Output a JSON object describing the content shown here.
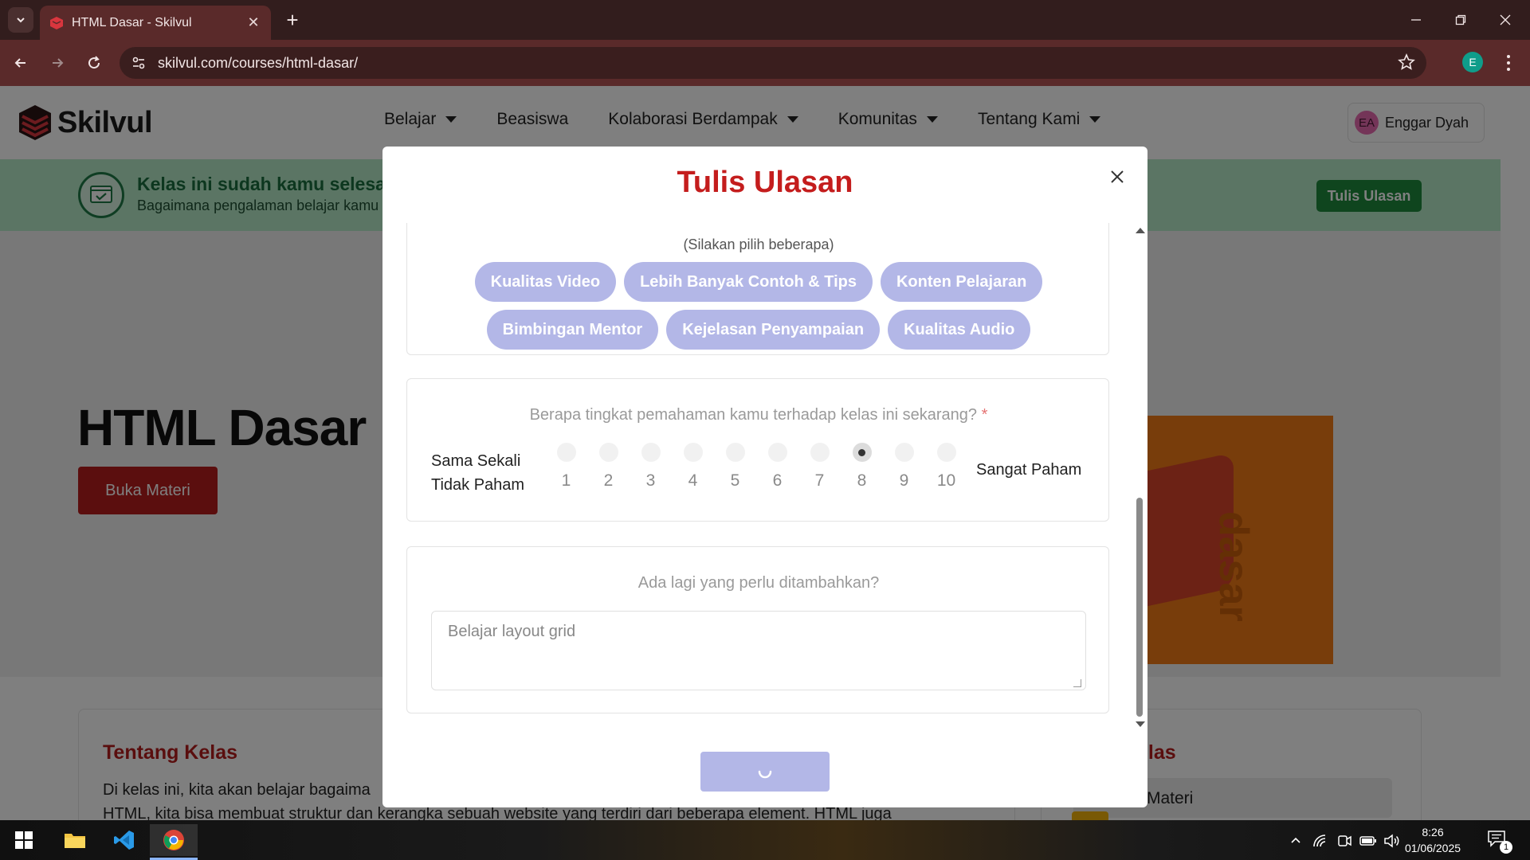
{
  "browser": {
    "tab_title": "HTML Dasar - Skilvul",
    "url": "skilvul.com/courses/html-dasar/",
    "profile_initial": "E"
  },
  "site": {
    "logo_text": "Skilvul",
    "nav": [
      "Belajar",
      "Beasiswa",
      "Kolaborasi Berdampak",
      "Komunitas",
      "Tentang Kami"
    ],
    "user": {
      "initials": "EA",
      "name": "Enggar Dyah"
    }
  },
  "banner": {
    "title": "Kelas ini sudah kamu selesaik",
    "subtitle": "Bagaimana pengalaman belajar kamu",
    "button": "Tulis Ulasan"
  },
  "hero": {
    "title": "HTML Dasar",
    "button": "Buka Materi",
    "art_word": "dasar"
  },
  "about": {
    "title": "Tentang Kelas",
    "text_line1": "Di kelas ini, kita akan belajar bagaima",
    "text_line2": "HTML, kita bisa membuat struktur dan kerangka sebuah website yang terdiri dari beberapa element. HTML juga"
  },
  "side_card": {
    "title_fragment": "elas",
    "row_label": "Materi"
  },
  "modal": {
    "title": "Tulis Ulasan",
    "hint": "(Silakan pilih beberapa)",
    "chips": [
      "Kualitas Video",
      "Lebih Banyak Contoh & Tips",
      "Konten Pelajaran",
      "Bimbingan Mentor",
      "Kejelasan Penyampaian",
      "Kualitas Audio"
    ],
    "question1": "Berapa tingkat pemahaman kamu terhadap kelas ini sekarang?",
    "required_mark": "*",
    "scale_min_label_line1": "Sama Sekali",
    "scale_min_label_line2": "Tidak Paham",
    "scale_max_label": "Sangat Paham",
    "scale": [
      "1",
      "2",
      "3",
      "4",
      "5",
      "6",
      "7",
      "8",
      "9",
      "10"
    ],
    "selected_value": 8,
    "question2": "Ada lagi yang perlu ditambahkan?",
    "textarea_value": "Belajar layout grid"
  },
  "taskbar": {
    "time": "8:26",
    "date": "01/06/2025",
    "notification_count": "1"
  },
  "colors": {
    "brand_red": "#c41d1d",
    "chip_bg": "#b3b7e7",
    "banner_bg": "#b6ebc8",
    "banner_btn": "#1e8b3d",
    "chrome_bg": "#321d1d"
  }
}
